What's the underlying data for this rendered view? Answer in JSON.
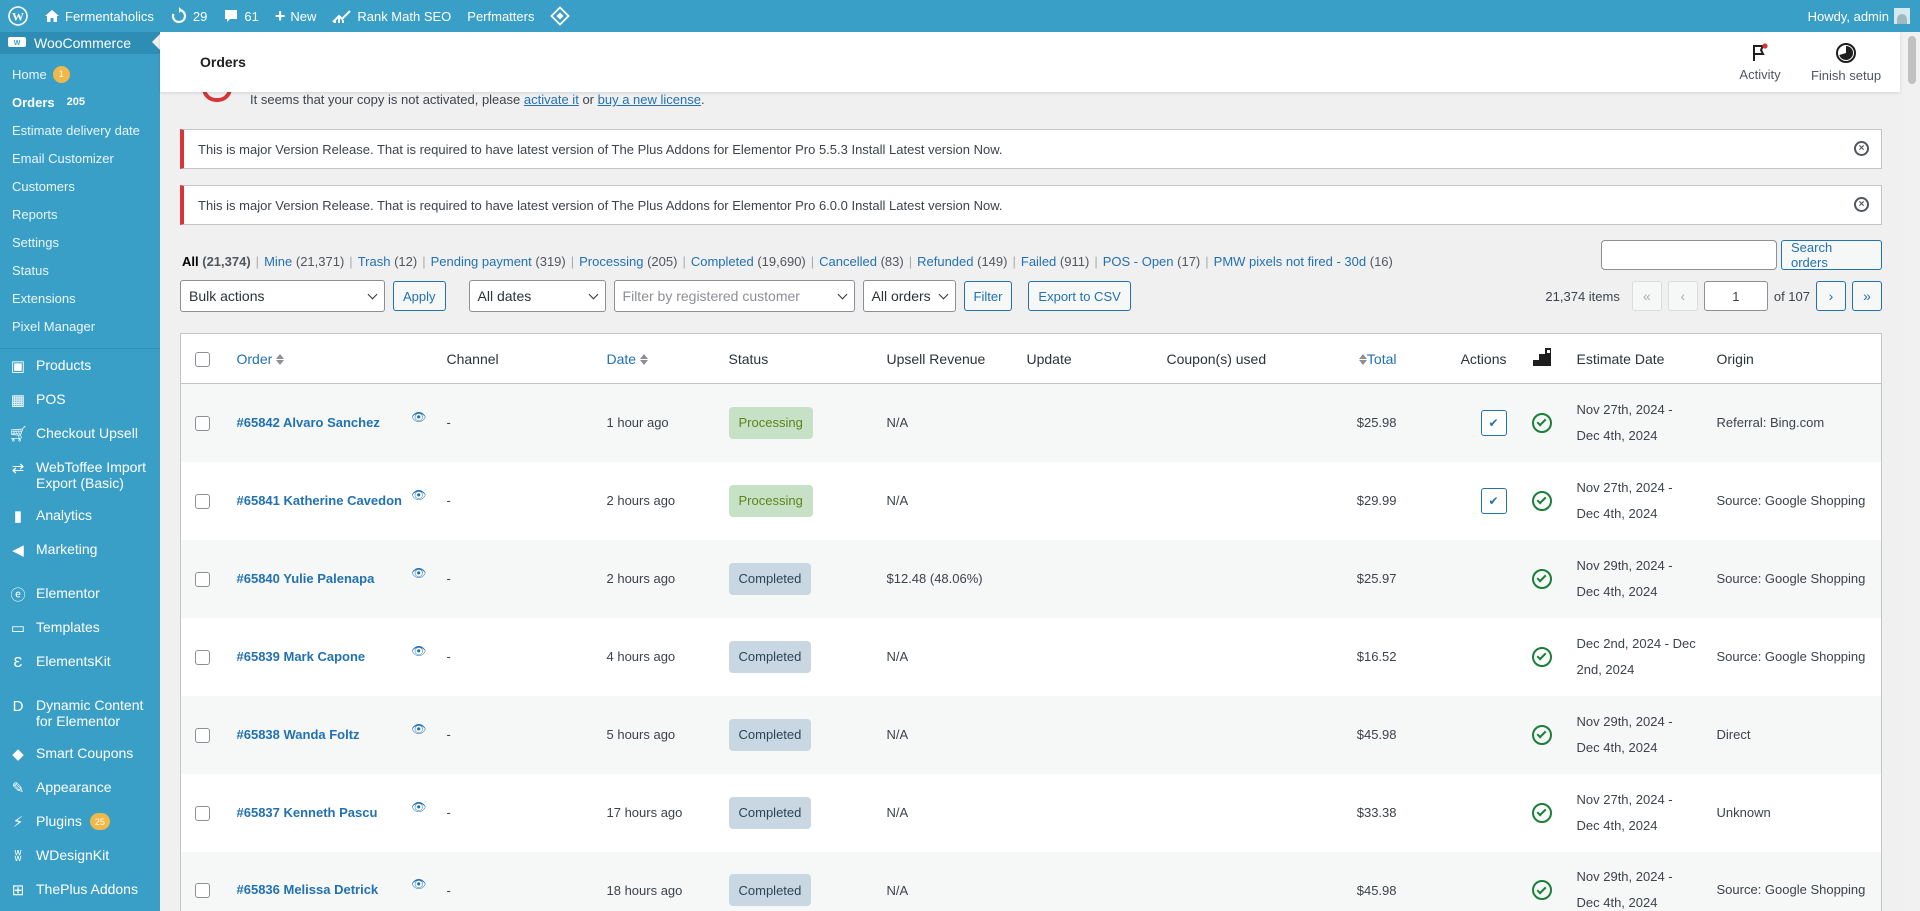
{
  "adminbar": {
    "site_name": "Fermentaholics",
    "updates_count": "29",
    "comments_count": "61",
    "new_label": "New",
    "rank_math": "Rank Math SEO",
    "perfmatters": "Perfmatters",
    "howdy": "Howdy, admin"
  },
  "sidebar": {
    "woocommerce_label": "WooCommerce",
    "sub": {
      "home": "Home",
      "home_badge": "1",
      "orders": "Orders",
      "orders_count": "205",
      "estimate": "Estimate delivery date",
      "email": "Email Customizer",
      "customers": "Customers",
      "reports": "Reports",
      "settings": "Settings",
      "status": "Status",
      "extensions": "Extensions",
      "pixel": "Pixel Manager"
    },
    "menu": {
      "products": "Products",
      "pos": "POS",
      "checkout_upsell": "Checkout Upsell",
      "webtoffee": "WebToffee Import Export (Basic)",
      "analytics": "Analytics",
      "marketing": "Marketing",
      "elementor": "Elementor",
      "templates": "Templates",
      "elementskit": "ElementsKit",
      "dynamic": "Dynamic Content for Elementor",
      "smart_coupons": "Smart Coupons",
      "appearance": "Appearance",
      "plugins": "Plugins",
      "plugins_badge": "25",
      "wdesignkit": "WDesignKit",
      "theplus": "ThePlus Addons"
    }
  },
  "header": {
    "title": "Orders",
    "activity": "Activity",
    "finish_setup": "Finish setup"
  },
  "notices": {
    "partial_text": "It seems that your copy is not activated, please",
    "activate_link": "activate it",
    "or": "or",
    "buy_link": "buy a new license",
    "notice1": "This is major Version Release. That is required to have latest version of The Plus Addons for Elementor Pro 5.5.3 Install Latest version Now.",
    "notice2": "This is major Version Release. That is required to have latest version of The Plus Addons for Elementor Pro 6.0.0 Install Latest version Now."
  },
  "filters": [
    {
      "label": "All",
      "count": "(21,374)",
      "current": true
    },
    {
      "label": "Mine",
      "count": "(21,371)"
    },
    {
      "label": "Trash",
      "count": "(12)"
    },
    {
      "label": "Pending payment",
      "count": "(319)"
    },
    {
      "label": "Processing",
      "count": "(205)"
    },
    {
      "label": "Completed",
      "count": "(19,690)"
    },
    {
      "label": "Cancelled",
      "count": "(83)"
    },
    {
      "label": "Refunded",
      "count": "(149)"
    },
    {
      "label": "Failed",
      "count": "(911)"
    },
    {
      "label": "POS - Open",
      "count": "(17)"
    },
    {
      "label": "PMW pixels not fired - 30d",
      "count": "(16)"
    }
  ],
  "search": {
    "button": "Search orders",
    "value": ""
  },
  "tablenav": {
    "bulk_actions": "Bulk actions",
    "apply": "Apply",
    "all_dates": "All dates",
    "customer_placeholder": "Filter by registered customer",
    "all_orders": "All orders",
    "filter": "Filter",
    "export": "Export to CSV",
    "items": "21,374 items",
    "first": "«",
    "prev": "‹",
    "current_page": "1",
    "of_pages": "of 107",
    "next": "›",
    "last": "»"
  },
  "columns": {
    "order": "Order",
    "channel": "Channel",
    "date": "Date",
    "status": "Status",
    "upsell": "Upsell Revenue",
    "update": "Update",
    "coupons": "Coupon(s) used",
    "total": "Total",
    "actions": "Actions",
    "estimate": "Estimate Date",
    "origin": "Origin"
  },
  "orders": [
    {
      "order": "#65842 Alvaro Sanchez",
      "channel": "-",
      "date": "1 hour ago",
      "status": "Processing",
      "status_key": "processing",
      "upsell": "N/A",
      "total": "$25.98",
      "has_action": true,
      "estimate": "Nov 27th, 2024 - Dec 4th, 2024",
      "origin": "Referral: Bing.com"
    },
    {
      "order": "#65841 Katherine Cavedon",
      "channel": "-",
      "date": "2 hours ago",
      "status": "Processing",
      "status_key": "processing",
      "upsell": "N/A",
      "total": "$29.99",
      "has_action": true,
      "estimate": "Nov 27th, 2024 - Dec 4th, 2024",
      "origin": "Source: Google Shopping"
    },
    {
      "order": "#65840 Yulie Palenapa",
      "channel": "-",
      "date": "2 hours ago",
      "status": "Completed",
      "status_key": "completed",
      "upsell": "$12.48 (48.06%)",
      "total": "$25.97",
      "has_action": false,
      "estimate": "Nov 29th, 2024 - Dec 4th, 2024",
      "origin": "Source: Google Shopping"
    },
    {
      "order": "#65839 Mark Capone",
      "channel": "-",
      "date": "4 hours ago",
      "status": "Completed",
      "status_key": "completed",
      "upsell": "N/A",
      "total": "$16.52",
      "has_action": false,
      "estimate": "Dec 2nd, 2024 - Dec 2nd, 2024",
      "origin": "Source: Google Shopping"
    },
    {
      "order": "#65838 Wanda Foltz",
      "channel": "-",
      "date": "5 hours ago",
      "status": "Completed",
      "status_key": "completed",
      "upsell": "N/A",
      "total": "$45.98",
      "has_action": false,
      "estimate": "Nov 29th, 2024 - Dec 4th, 2024",
      "origin": "Direct"
    },
    {
      "order": "#65837 Kenneth Pascu",
      "channel": "-",
      "date": "17 hours ago",
      "status": "Completed",
      "status_key": "completed",
      "upsell": "N/A",
      "total": "$33.38",
      "has_action": false,
      "estimate": "Nov 27th, 2024 - Dec 4th, 2024",
      "origin": "Unknown"
    },
    {
      "order": "#65836 Melissa Detrick",
      "channel": "-",
      "date": "18 hours ago",
      "status": "Completed",
      "status_key": "completed",
      "upsell": "N/A",
      "total": "$45.98",
      "has_action": false,
      "estimate": "Nov 29th, 2024 - Dec 4th, 2024",
      "origin": "Source: Google Shopping"
    }
  ]
}
